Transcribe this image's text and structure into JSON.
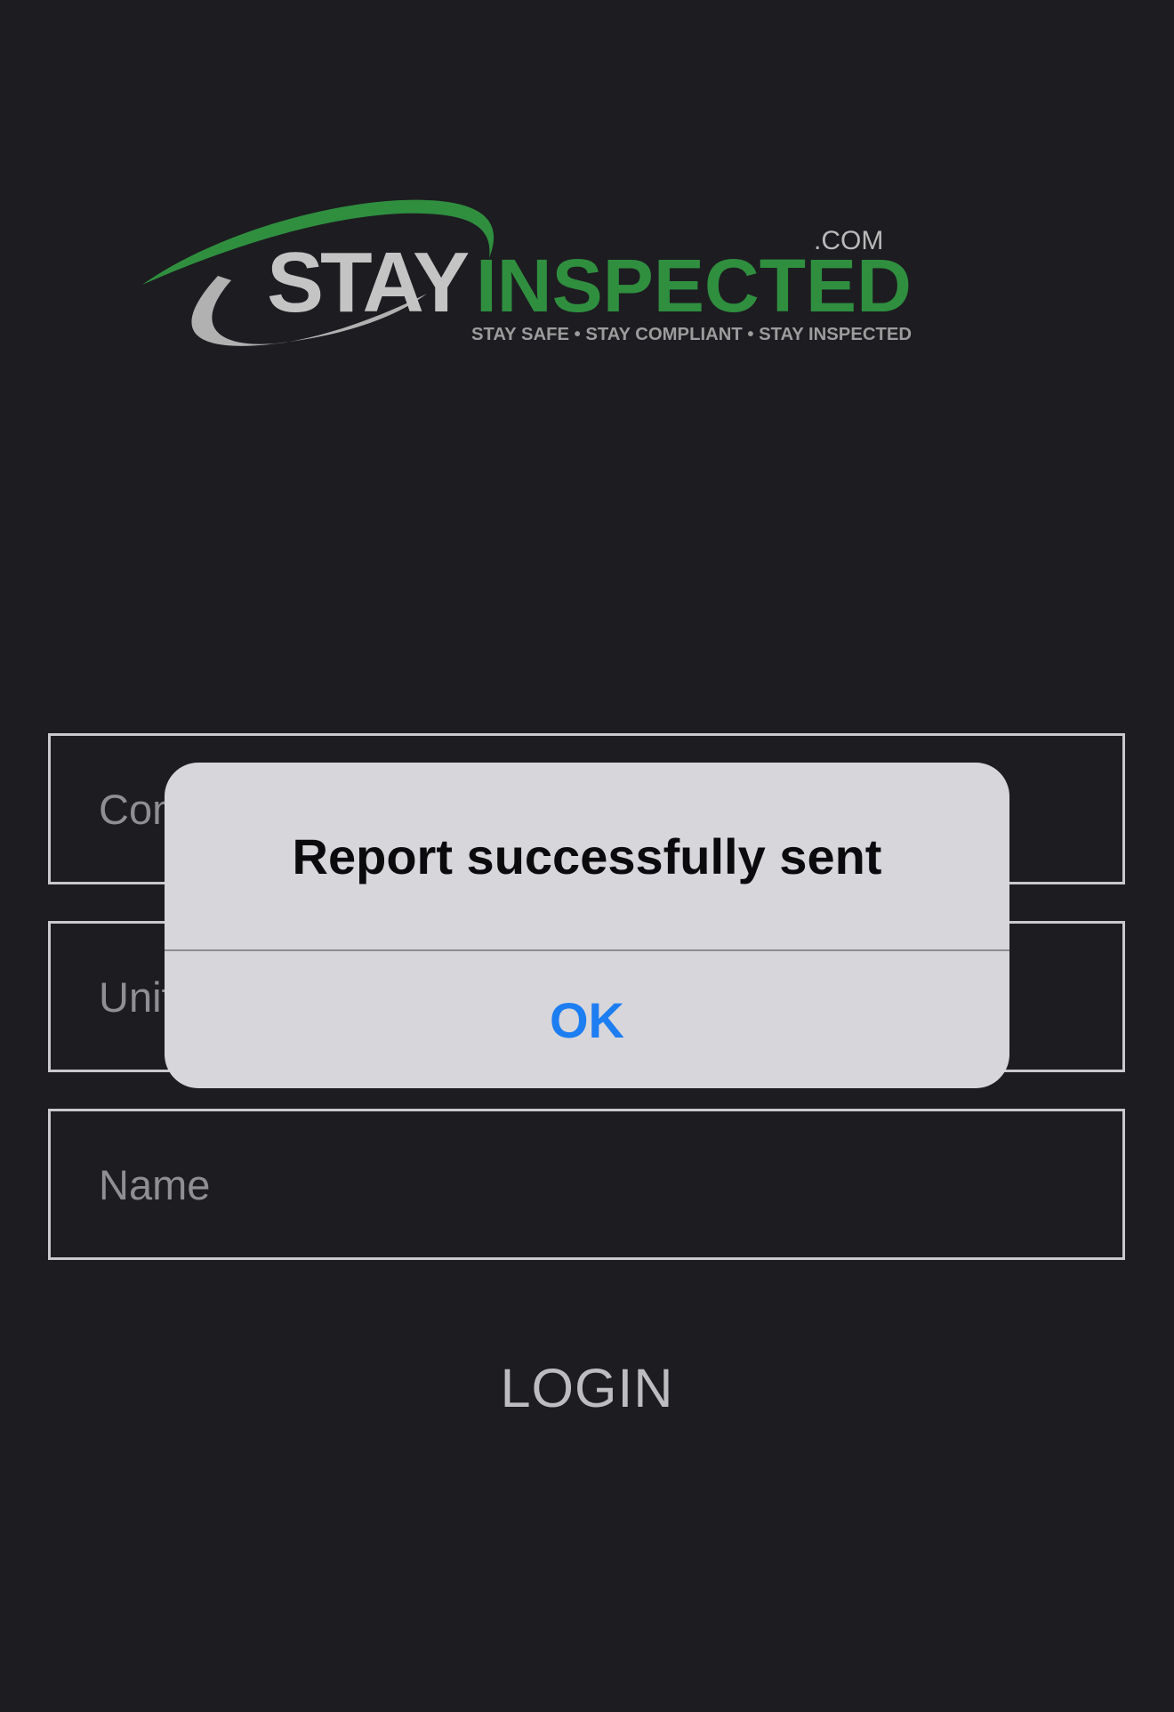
{
  "logo": {
    "word_stay": "STAY",
    "word_inspected": "INSPECTED",
    "dotcom": ".COM",
    "tagline": "STAY SAFE • STAY COMPLIANT • STAY INSPECTED",
    "colors": {
      "green": "#2f8f3f",
      "gray": "#b3b3b3"
    }
  },
  "form": {
    "company_placeholder": "Company",
    "unit_placeholder": "Unit",
    "name_placeholder": "Name",
    "login_label": "LOGIN"
  },
  "alert": {
    "message": "Report successfully sent",
    "ok_label": "OK",
    "colors": {
      "ok": "#1d7ef2",
      "background": "#d7d6db"
    }
  }
}
